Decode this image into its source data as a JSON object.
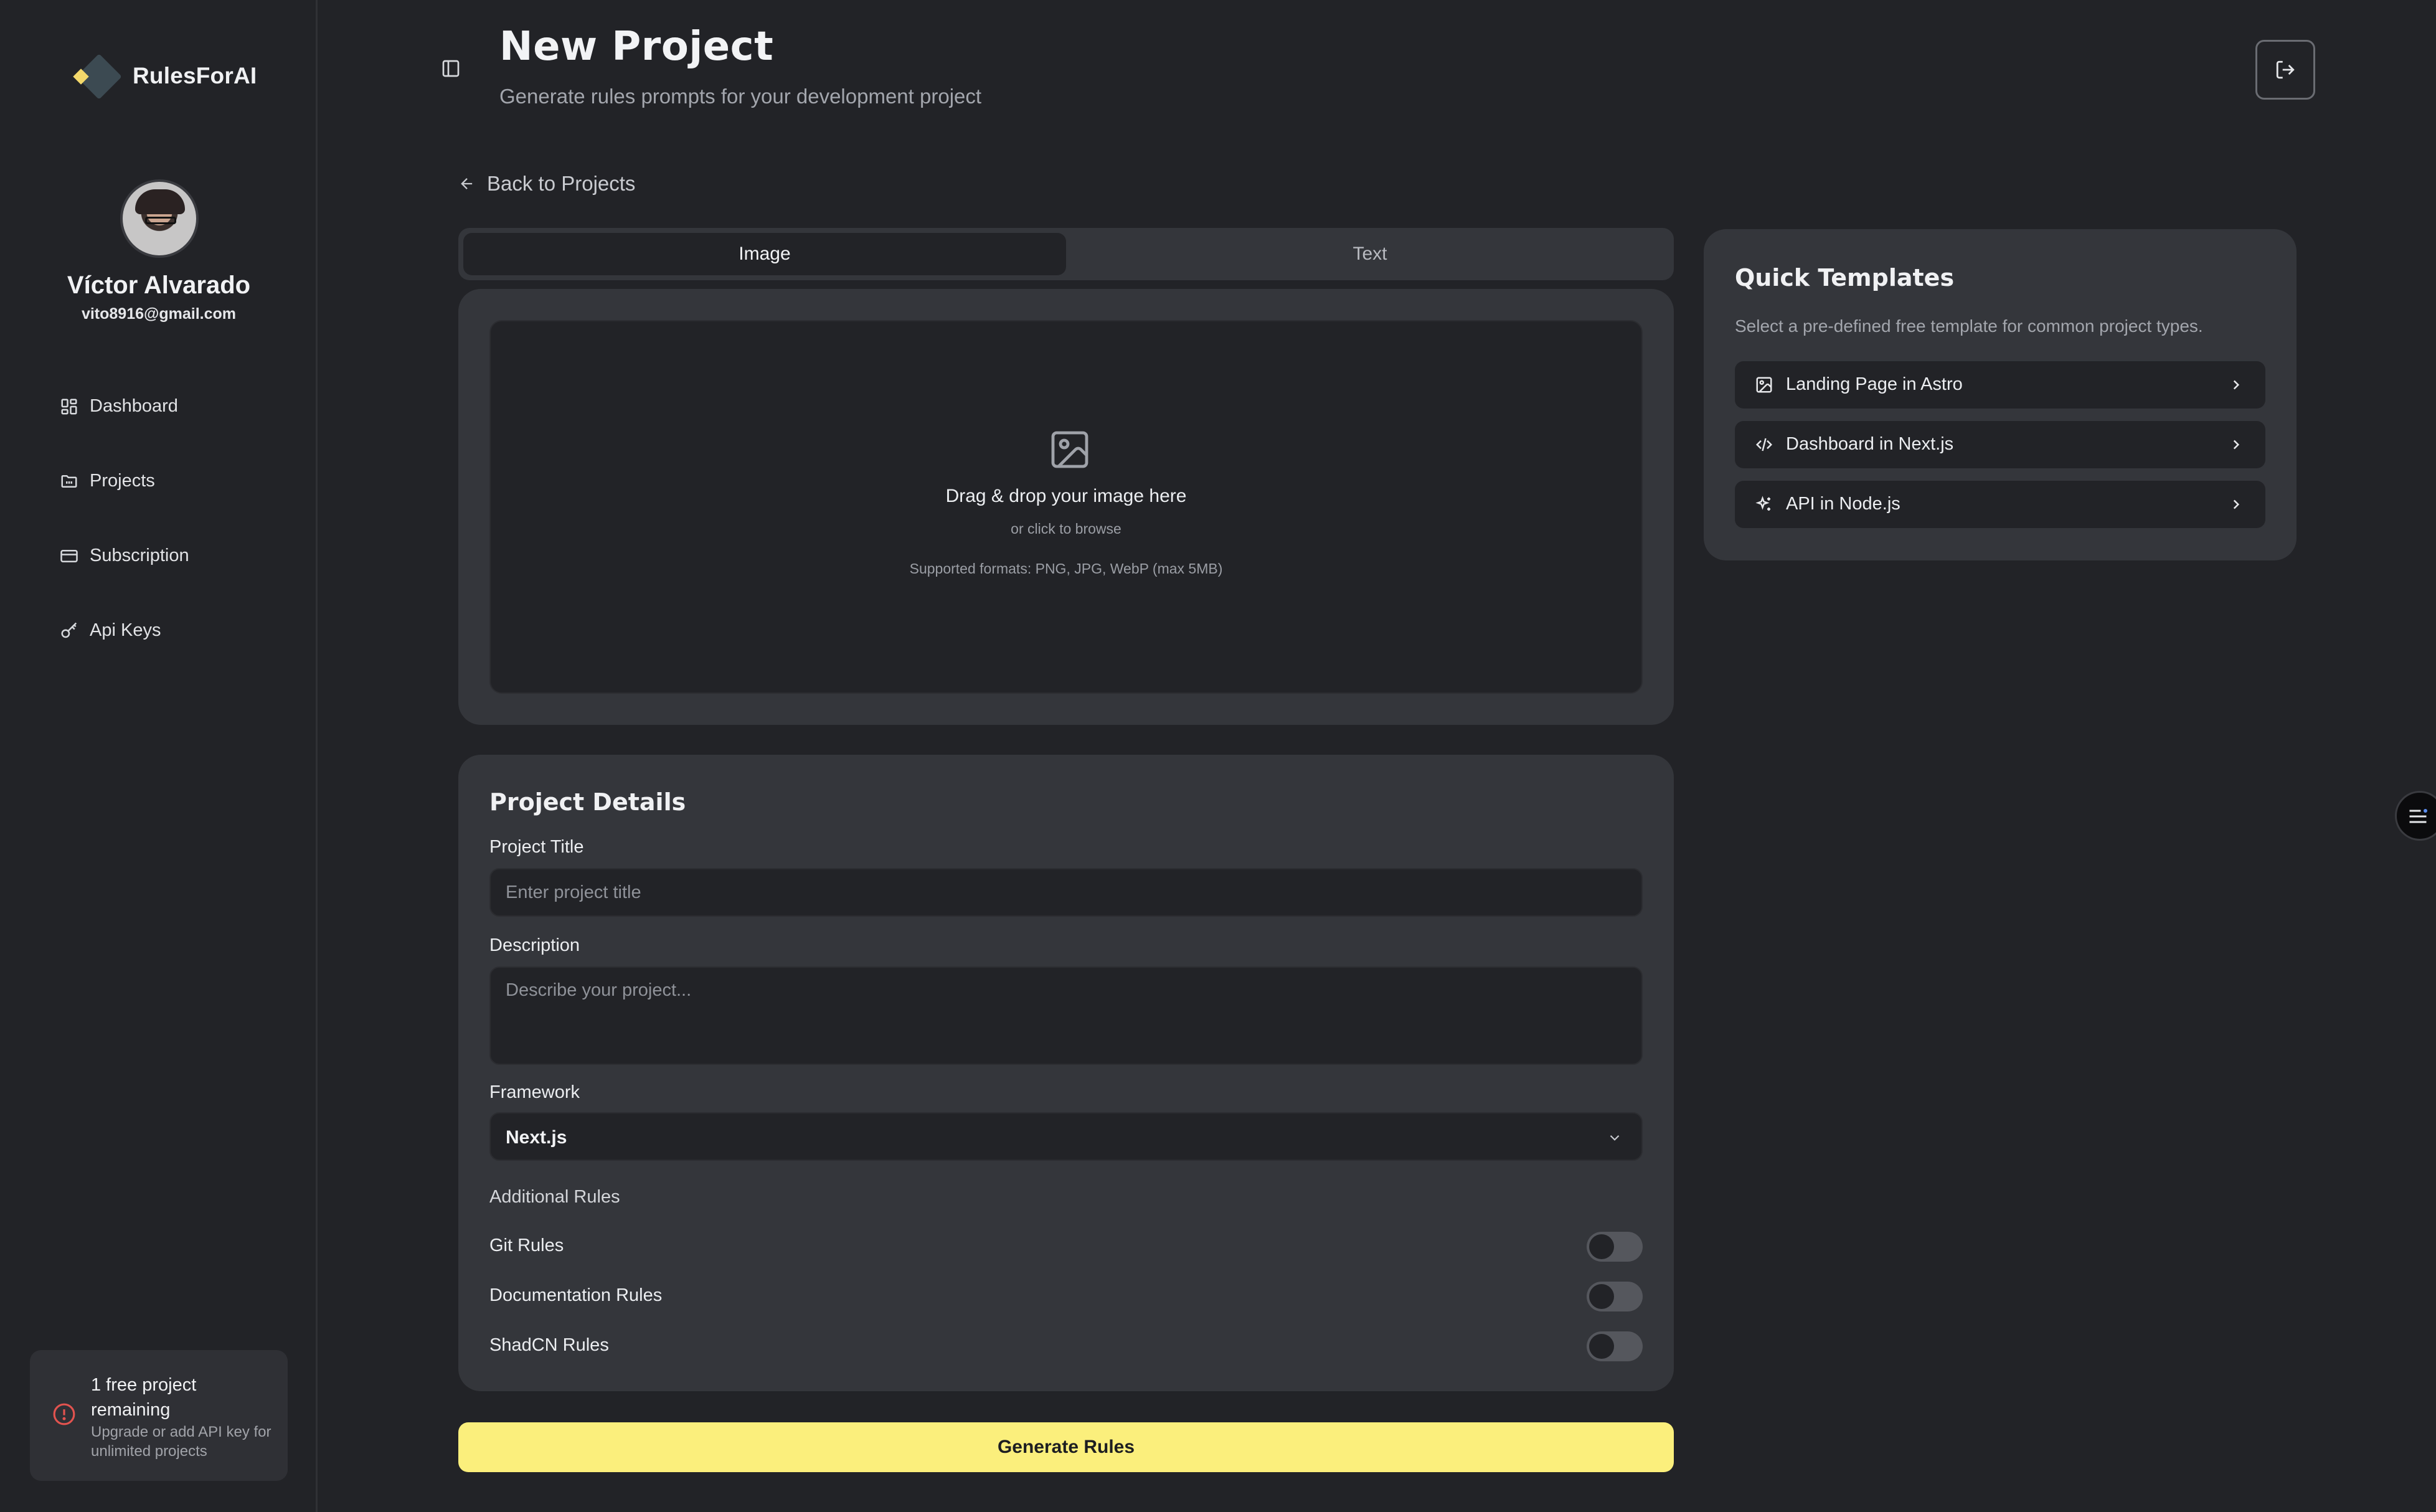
{
  "app": {
    "brand_name": "RulesForAI",
    "accent_color": "#fbef7c"
  },
  "user": {
    "name": "Víctor Alvarado",
    "email": "vito8916@gmail.com"
  },
  "sidebar": {
    "items": [
      {
        "label": "Dashboard",
        "icon": "dashboard-icon"
      },
      {
        "label": "Projects",
        "icon": "folder-icon"
      },
      {
        "label": "Subscription",
        "icon": "credit-card-icon"
      },
      {
        "label": "Api Keys",
        "icon": "key-icon"
      }
    ],
    "free_notice": {
      "title": "1 free project remaining",
      "subtitle": "Upgrade or add API key for unlimited projects",
      "icon": "alert-circle-icon",
      "icon_color": "#e2534f"
    }
  },
  "header": {
    "title": "New Project",
    "subtitle": "Generate rules prompts for your development project"
  },
  "back_link": "Back to Projects",
  "input_tabs": {
    "tabs": [
      "Image",
      "Text"
    ],
    "selected": "Image"
  },
  "upload": {
    "main": "Drag & drop your image here",
    "sub": "or click to browse",
    "formats": "Supported formats: PNG, JPG, WebP (max 5MB)"
  },
  "details": {
    "title": "Project Details",
    "project_title_label": "Project Title",
    "project_title_placeholder": "Enter project title",
    "description_label": "Description",
    "description_placeholder": "Describe your project...",
    "framework_label": "Framework",
    "framework_value": "Next.js",
    "additional_rules_label": "Additional Rules",
    "rules": [
      {
        "label": "Git Rules",
        "enabled": false
      },
      {
        "label": "Documentation Rules",
        "enabled": false
      },
      {
        "label": "ShadCN Rules",
        "enabled": false
      }
    ]
  },
  "generate_button": "Generate Rules",
  "templates": {
    "title": "Quick Templates",
    "subtitle": "Select a pre-defined free template for common project types.",
    "items": [
      {
        "label": "Landing Page in Astro",
        "icon": "image-icon"
      },
      {
        "label": "Dashboard in Next.js",
        "icon": "code-icon"
      },
      {
        "label": "API in Node.js",
        "icon": "sparkles-icon"
      }
    ]
  }
}
